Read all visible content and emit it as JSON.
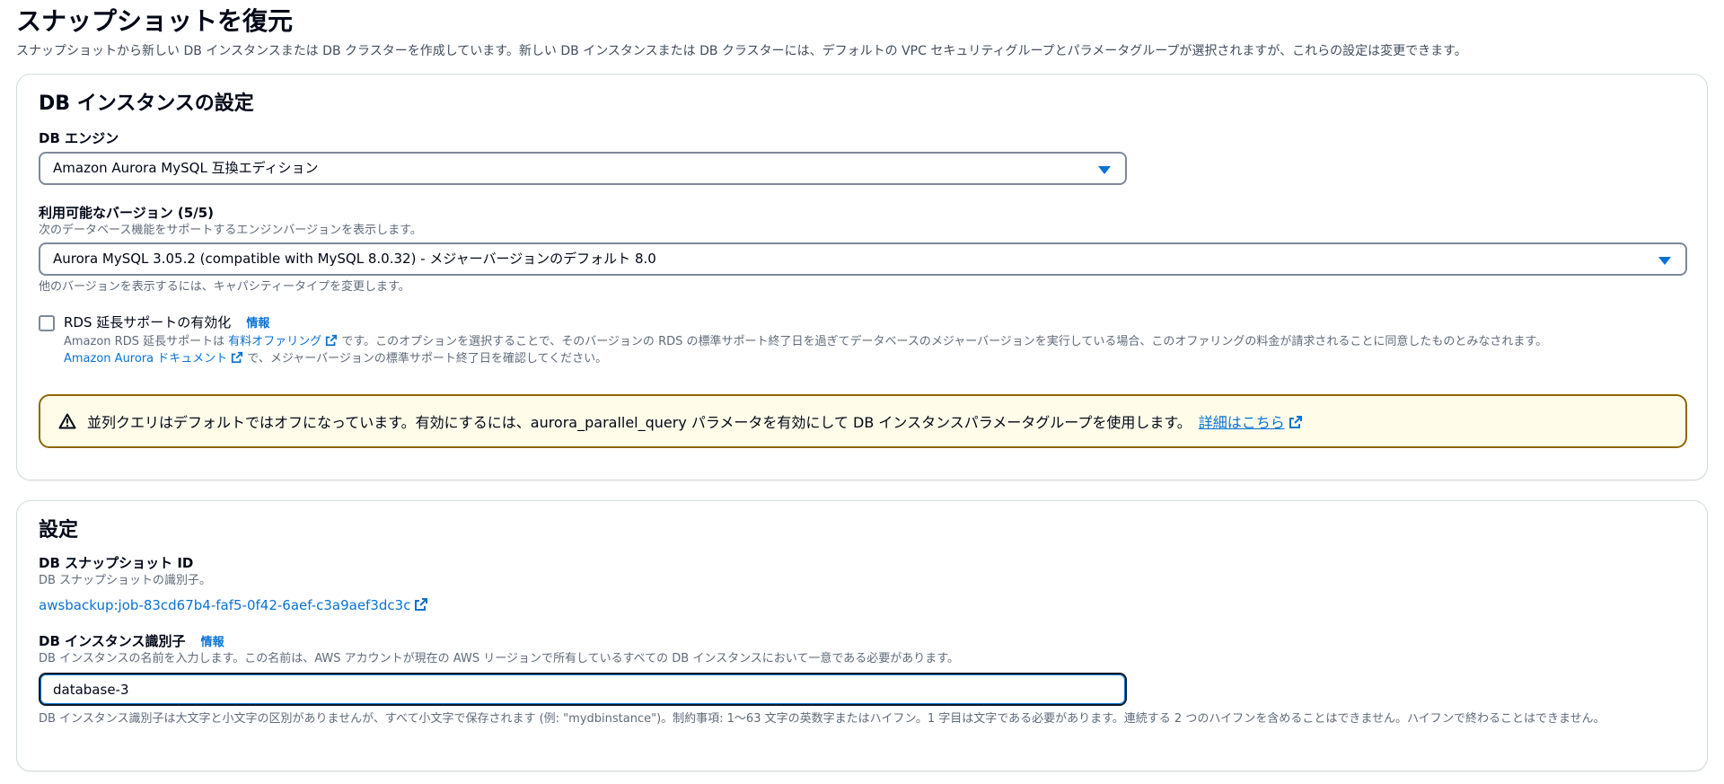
{
  "page": {
    "title": "スナップショットを復元",
    "description": "スナップショットから新しい DB インスタンスまたは DB クラスターを作成しています。新しい DB インスタンスまたは DB クラスターには、デフォルトの VPC セキュリティグループとパラメータグループが選択されますが、これらの設定は変更できます。"
  },
  "instance_settings": {
    "title": "DB インスタンスの設定",
    "engine_label": "DB エンジン",
    "engine_value": "Amazon Aurora MySQL 互換エディション",
    "version_label": "利用可能なバージョン (5/5)",
    "version_desc": "次のデータベース機能をサポートするエンジンバージョンを表示します。",
    "version_value": "Aurora MySQL 3.05.2 (compatible with MySQL 8.0.32) - メジャーバージョンのデフォルト 8.0",
    "version_hint": "他のバージョンを表示するには、キャパシティータイプを変更します。",
    "extended_support": {
      "label": "RDS 延長サポートの有効化",
      "info": "情報",
      "desc_prefix": "Amazon RDS 延長サポートは",
      "desc_link": "有料オファリング",
      "desc_suffix": "です。このオプションを選択することで、そのバージョンの RDS の標準サポート終了日を過ぎてデータベースのメジャーバージョンを実行している場合、このオファリングの料金が請求されることに同意したものとみなされます。",
      "doc_link": "Amazon Aurora ドキュメント",
      "doc_suffix": "で、メジャーバージョンの標準サポート終了日を確認してください。",
      "checked": false
    },
    "alert": {
      "text": "並列クエリはデフォルトではオフになっています。有効にするには、aurora_parallel_query パラメータを有効にして DB インスタンスパラメータグループを使用します。",
      "link": "詳細はこちら"
    }
  },
  "settings": {
    "title": "設定",
    "snapshot_id_label": "DB スナップショット ID",
    "snapshot_id_desc": "DB スナップショットの識別子。",
    "snapshot_id_value": "awsbackup:job-83cd67b4-faf5-0f42-6aef-c3a9aef3dc3c",
    "instance_id_label": "DB インスタンス識別子",
    "instance_id_info": "情報",
    "instance_id_desc": "DB インスタンスの名前を入力します。この名前は、AWS アカウントが現在の AWS リージョンで所有しているすべての DB インスタンスにおいて一意である必要があります。",
    "instance_id_value": "database-3",
    "instance_id_hint": "DB インスタンス識別子は大文字と小文字の区別がありませんが、すべて小文字で保存されます (例: \"mydbinstance\")。制約事項: 1～63 文字の英数字またはハイフン。1 字目は文字である必要があります。連続する 2 つのハイフンを含めることはできません。ハイフンで終わることはできません。"
  },
  "colors": {
    "link": "#0972d3",
    "warning_border": "#8d6605",
    "warning_bg": "#fffce9"
  }
}
